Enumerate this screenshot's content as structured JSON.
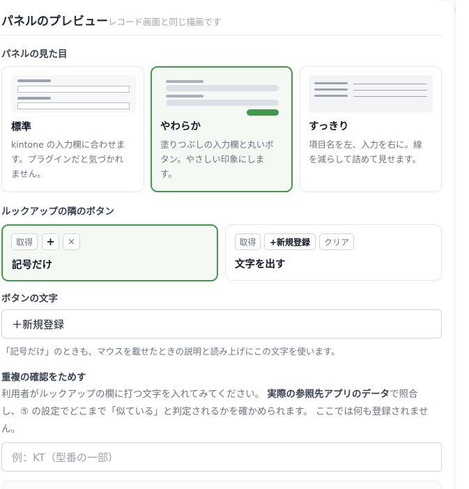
{
  "header": {
    "title": "パネルのプレビュー",
    "subtitle": "レコード画面と同じ描画です"
  },
  "appearance": {
    "label": "パネルの見た目",
    "options": [
      {
        "name": "標準",
        "desc_lines": [
          "kintone の入力欄に合わせま",
          "す。プラグインだと気づかれ",
          "ません。"
        ],
        "selected": false
      },
      {
        "name": "やわらか",
        "desc_lines": [
          "塗りつぶしの入力欄と丸いボ",
          "タン。やさしい印象にしま",
          "す。"
        ],
        "selected": true
      },
      {
        "name": "すっきり",
        "desc_lines": [
          "項目名を左、入力を右に。線",
          "を減らして詰めて見せます。"
        ],
        "selected": false
      }
    ]
  },
  "lookup_buttons": {
    "label": "ルックアップの隣のボタン",
    "options": [
      {
        "name": "記号だけ",
        "selected": true,
        "chips": [
          "取得",
          "+",
          "×"
        ]
      },
      {
        "name": "文字を出す",
        "selected": false,
        "chips": [
          "取得",
          "+新規登録",
          "クリア"
        ]
      }
    ]
  },
  "button_text": {
    "label": "ボタンの文字",
    "value": "＋新規登録",
    "help": "「記号だけ」のときも、マウスを載せたときの説明と読み上げにこの文字を使います。"
  },
  "dup_check": {
    "label": "重複の確認をためす",
    "line1_pre": "利用者がルックアップの欄に打つ文字を入れてみてください。 ",
    "line1_bold": "実際の参照先アプリのデータ",
    "line1_post": "で照合",
    "line2": "し、⑤ の設定でどこまで「似ている」と判定されるかを確かめられます。 ここでは何も登録されませ",
    "line3": "ん。",
    "placeholder": "例：KT（型番の一部）"
  },
  "colors": {
    "accent": "#3f9a4a",
    "selected_bg": "#f4faf3",
    "border": "#e5e7eb"
  }
}
